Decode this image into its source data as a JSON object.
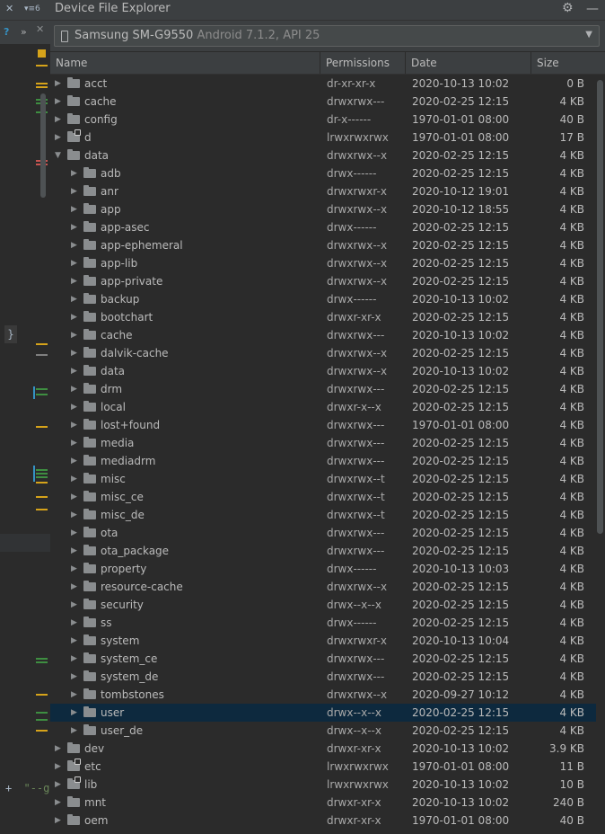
{
  "left_panel": {
    "tab_close": "✕",
    "tab_menu": "▾≡6",
    "tool_help": "?",
    "tool_expand": "»",
    "tool_close": "✕",
    "brace": "}",
    "snippet_plus": "+",
    "snippet_text": "\"--g"
  },
  "explorer": {
    "title": "Device File Explorer",
    "device": {
      "name": "Samsung SM-G9550",
      "details": "Android 7.1.2, API 25"
    },
    "columns": {
      "name": "Name",
      "permissions": "Permissions",
      "date": "Date",
      "size": "Size"
    },
    "rows": [
      {
        "name": "acct",
        "perm": "dr-xr-xr-x",
        "date": "2020-10-13 10:02",
        "size": "0 B",
        "level": 0,
        "expanded": false,
        "link": false
      },
      {
        "name": "cache",
        "perm": "drwxrwx---",
        "date": "2020-02-25 12:15",
        "size": "4 KB",
        "level": 0,
        "expanded": false,
        "link": false
      },
      {
        "name": "config",
        "perm": "dr-x------",
        "date": "1970-01-01 08:00",
        "size": "40 B",
        "level": 0,
        "expanded": false,
        "link": false
      },
      {
        "name": "d",
        "perm": "lrwxrwxrwx",
        "date": "1970-01-01 08:00",
        "size": "17 B",
        "level": 0,
        "expanded": false,
        "link": true
      },
      {
        "name": "data",
        "perm": "drwxrwx--x",
        "date": "2020-02-25 12:15",
        "size": "4 KB",
        "level": 0,
        "expanded": true,
        "link": false
      },
      {
        "name": "adb",
        "perm": "drwx------",
        "date": "2020-02-25 12:15",
        "size": "4 KB",
        "level": 1,
        "expanded": false,
        "link": false
      },
      {
        "name": "anr",
        "perm": "drwxrwxr-x",
        "date": "2020-10-12 19:01",
        "size": "4 KB",
        "level": 1,
        "expanded": false,
        "link": false
      },
      {
        "name": "app",
        "perm": "drwxrwx--x",
        "date": "2020-10-12 18:55",
        "size": "4 KB",
        "level": 1,
        "expanded": false,
        "link": false
      },
      {
        "name": "app-asec",
        "perm": "drwx------",
        "date": "2020-02-25 12:15",
        "size": "4 KB",
        "level": 1,
        "expanded": false,
        "link": false
      },
      {
        "name": "app-ephemeral",
        "perm": "drwxrwx--x",
        "date": "2020-02-25 12:15",
        "size": "4 KB",
        "level": 1,
        "expanded": false,
        "link": false
      },
      {
        "name": "app-lib",
        "perm": "drwxrwx--x",
        "date": "2020-02-25 12:15",
        "size": "4 KB",
        "level": 1,
        "expanded": false,
        "link": false
      },
      {
        "name": "app-private",
        "perm": "drwxrwx--x",
        "date": "2020-02-25 12:15",
        "size": "4 KB",
        "level": 1,
        "expanded": false,
        "link": false
      },
      {
        "name": "backup",
        "perm": "drwx------",
        "date": "2020-10-13 10:02",
        "size": "4 KB",
        "level": 1,
        "expanded": false,
        "link": false
      },
      {
        "name": "bootchart",
        "perm": "drwxr-xr-x",
        "date": "2020-02-25 12:15",
        "size": "4 KB",
        "level": 1,
        "expanded": false,
        "link": false
      },
      {
        "name": "cache",
        "perm": "drwxrwx---",
        "date": "2020-10-13 10:02",
        "size": "4 KB",
        "level": 1,
        "expanded": false,
        "link": false
      },
      {
        "name": "dalvik-cache",
        "perm": "drwxrwx--x",
        "date": "2020-02-25 12:15",
        "size": "4 KB",
        "level": 1,
        "expanded": false,
        "link": false
      },
      {
        "name": "data",
        "perm": "drwxrwx--x",
        "date": "2020-10-13 10:02",
        "size": "4 KB",
        "level": 1,
        "expanded": false,
        "link": false
      },
      {
        "name": "drm",
        "perm": "drwxrwx---",
        "date": "2020-02-25 12:15",
        "size": "4 KB",
        "level": 1,
        "expanded": false,
        "link": false
      },
      {
        "name": "local",
        "perm": "drwxr-x--x",
        "date": "2020-02-25 12:15",
        "size": "4 KB",
        "level": 1,
        "expanded": false,
        "link": false
      },
      {
        "name": "lost+found",
        "perm": "drwxrwx---",
        "date": "1970-01-01 08:00",
        "size": "4 KB",
        "level": 1,
        "expanded": false,
        "link": false
      },
      {
        "name": "media",
        "perm": "drwxrwx---",
        "date": "2020-02-25 12:15",
        "size": "4 KB",
        "level": 1,
        "expanded": false,
        "link": false
      },
      {
        "name": "mediadrm",
        "perm": "drwxrwx---",
        "date": "2020-02-25 12:15",
        "size": "4 KB",
        "level": 1,
        "expanded": false,
        "link": false
      },
      {
        "name": "misc",
        "perm": "drwxrwx--t",
        "date": "2020-02-25 12:15",
        "size": "4 KB",
        "level": 1,
        "expanded": false,
        "link": false
      },
      {
        "name": "misc_ce",
        "perm": "drwxrwx--t",
        "date": "2020-02-25 12:15",
        "size": "4 KB",
        "level": 1,
        "expanded": false,
        "link": false
      },
      {
        "name": "misc_de",
        "perm": "drwxrwx--t",
        "date": "2020-02-25 12:15",
        "size": "4 KB",
        "level": 1,
        "expanded": false,
        "link": false
      },
      {
        "name": "ota",
        "perm": "drwxrwx---",
        "date": "2020-02-25 12:15",
        "size": "4 KB",
        "level": 1,
        "expanded": false,
        "link": false
      },
      {
        "name": "ota_package",
        "perm": "drwxrwx---",
        "date": "2020-02-25 12:15",
        "size": "4 KB",
        "level": 1,
        "expanded": false,
        "link": false
      },
      {
        "name": "property",
        "perm": "drwx------",
        "date": "2020-10-13 10:03",
        "size": "4 KB",
        "level": 1,
        "expanded": false,
        "link": false
      },
      {
        "name": "resource-cache",
        "perm": "drwxrwx--x",
        "date": "2020-02-25 12:15",
        "size": "4 KB",
        "level": 1,
        "expanded": false,
        "link": false
      },
      {
        "name": "security",
        "perm": "drwx--x--x",
        "date": "2020-02-25 12:15",
        "size": "4 KB",
        "level": 1,
        "expanded": false,
        "link": false
      },
      {
        "name": "ss",
        "perm": "drwx------",
        "date": "2020-02-25 12:15",
        "size": "4 KB",
        "level": 1,
        "expanded": false,
        "link": false
      },
      {
        "name": "system",
        "perm": "drwxrwxr-x",
        "date": "2020-10-13 10:04",
        "size": "4 KB",
        "level": 1,
        "expanded": false,
        "link": false
      },
      {
        "name": "system_ce",
        "perm": "drwxrwx---",
        "date": "2020-02-25 12:15",
        "size": "4 KB",
        "level": 1,
        "expanded": false,
        "link": false
      },
      {
        "name": "system_de",
        "perm": "drwxrwx---",
        "date": "2020-02-25 12:15",
        "size": "4 KB",
        "level": 1,
        "expanded": false,
        "link": false
      },
      {
        "name": "tombstones",
        "perm": "drwxrwx--x",
        "date": "2020-09-27 10:12",
        "size": "4 KB",
        "level": 1,
        "expanded": false,
        "link": false
      },
      {
        "name": "user",
        "perm": "drwx--x--x",
        "date": "2020-02-25 12:15",
        "size": "4 KB",
        "level": 1,
        "expanded": false,
        "link": false,
        "selected": true
      },
      {
        "name": "user_de",
        "perm": "drwx--x--x",
        "date": "2020-02-25 12:15",
        "size": "4 KB",
        "level": 1,
        "expanded": false,
        "link": false
      },
      {
        "name": "dev",
        "perm": "drwxr-xr-x",
        "date": "2020-10-13 10:02",
        "size": "3.9 KB",
        "level": 0,
        "expanded": false,
        "link": false
      },
      {
        "name": "etc",
        "perm": "lrwxrwxrwx",
        "date": "1970-01-01 08:00",
        "size": "11 B",
        "level": 0,
        "expanded": false,
        "link": true
      },
      {
        "name": "lib",
        "perm": "lrwxrwxrwx",
        "date": "2020-10-13 10:02",
        "size": "10 B",
        "level": 0,
        "expanded": false,
        "link": true
      },
      {
        "name": "mnt",
        "perm": "drwxr-xr-x",
        "date": "2020-10-13 10:02",
        "size": "240 B",
        "level": 0,
        "expanded": false,
        "link": false
      },
      {
        "name": "oem",
        "perm": "drwxr-xr-x",
        "date": "1970-01-01 08:00",
        "size": "40 B",
        "level": 0,
        "expanded": false,
        "link": false
      }
    ]
  },
  "colors": {
    "background": "#2b2b2b",
    "toolbar": "#3c3f41",
    "selection": "#0d293e",
    "text": "#bbbbbb",
    "folder": "#8a8d8f",
    "gutter_yellow": "#d6a31a",
    "gutter_green": "#3e8e41",
    "gutter_red": "#c75450",
    "help_blue": "#3592c4",
    "string_green": "#6a8759"
  }
}
